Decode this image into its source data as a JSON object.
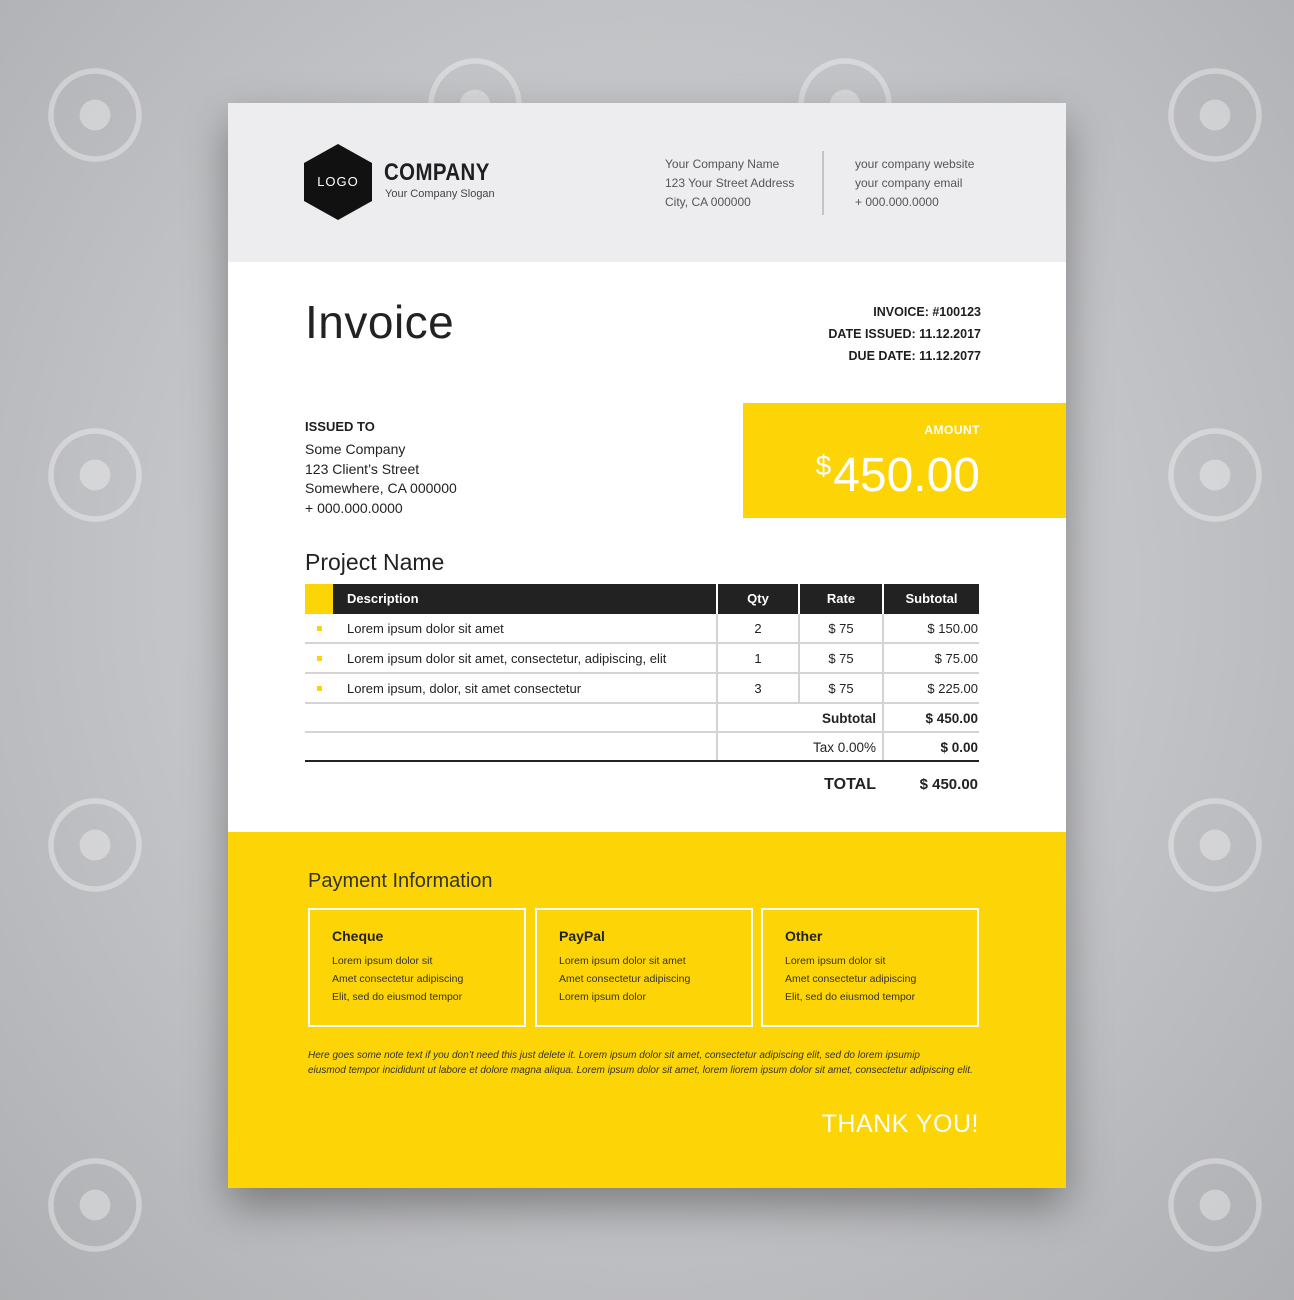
{
  "header": {
    "logo_text": "LOGO",
    "company_name": "COMPANY",
    "company_slogan": "Your Company Slogan",
    "address": [
      "Your Company Name",
      "123 Your Street Address",
      "City, CA 000000"
    ],
    "contact": [
      "your company website",
      "your company email",
      "+ 000.000.0000"
    ]
  },
  "invoice": {
    "title": "Invoice",
    "number": "INVOICE: #100123",
    "date_issued": "DATE ISSUED: 11.12.2017",
    "due_date": "DUE DATE: 11.12.2077"
  },
  "issued_to": {
    "label": "ISSUED TO",
    "lines": [
      "Some Company",
      "123 Client’s Street",
      "Somewhere, CA 000000",
      "+ 000.000.0000"
    ]
  },
  "amount": {
    "label": "AMOUNT",
    "currency": "$",
    "value": "450.00"
  },
  "project": {
    "name": "Project Name"
  },
  "table": {
    "headers": [
      "Description",
      "Qty",
      "Rate",
      "Subtotal"
    ],
    "rows": [
      {
        "description": "Lorem ipsum dolor sit amet",
        "qty": "2",
        "rate": "$ 75",
        "subtotal": "$ 150.00"
      },
      {
        "description": "Lorem ipsum dolor sit amet, consectetur, adipiscing, elit",
        "qty": "1",
        "rate": "$ 75",
        "subtotal": "$ 75.00"
      },
      {
        "description": "Lorem ipsum, dolor, sit amet consectetur",
        "qty": "3",
        "rate": "$ 75",
        "subtotal": "$ 225.00"
      }
    ],
    "subtotal_label": "Subtotal",
    "subtotal_value": "$ 450.00",
    "tax_label": "Tax 0.00%",
    "tax_value": "$ 0.00",
    "total_label": "TOTAL",
    "total_value": "$ 450.00"
  },
  "payment": {
    "title": "Payment Information",
    "methods": [
      {
        "title": "Cheque",
        "lines": [
          "Lorem ipsum dolor sit",
          "Amet consectetur adipiscing",
          "Elit, sed do eiusmod tempor"
        ]
      },
      {
        "title": "PayPal",
        "lines": [
          "Lorem ipsum dolor sit amet",
          "Amet consectetur adipiscing",
          "Lorem ipsum dolor"
        ]
      },
      {
        "title": "Other",
        "lines": [
          "Lorem ipsum dolor sit",
          "Amet consectetur adipiscing",
          "Elit, sed do eiusmod tempor"
        ]
      }
    ],
    "note_lines": [
      "Here goes some note text if you don’t need this just delete it. Lorem ipsum dolor sit amet, consectetur adipiscing elit, sed do lorem ipsumip",
      "eiusmod  tempor incididunt ut labore et dolore magna aliqua. Lorem ipsum dolor sit amet, lorem liorem ipsum dolor sit amet, consectetur adipiscing elit."
    ],
    "thanks": "THANK YOU!"
  },
  "colors": {
    "accent": "#fdd405",
    "dark": "#222222",
    "header_bg": "#ededef"
  }
}
